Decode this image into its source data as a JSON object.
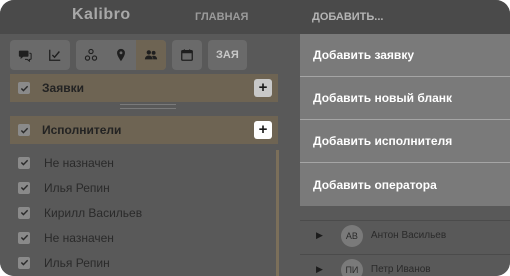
{
  "header": {
    "logo": "Kalibro",
    "nav_home": "ГЛАВНАЯ",
    "nav_add": "ДОБАВИТЬ..."
  },
  "toolbar": {
    "buttons": [
      "chat-icon",
      "checklist-icon",
      "network-icon",
      "map-pin-icon",
      "users-icon",
      "calendar-icon"
    ],
    "active": "users-icon",
    "truncated_label": "ЗАЯ"
  },
  "sections": {
    "requests_label": "Заявки",
    "executors_label": "Исполнители"
  },
  "executors": [
    "Не назначен",
    "Илья Репин",
    "Кирилл Васильев",
    "Не назначен",
    "Илья Репин"
  ],
  "right_list": [
    {
      "initials": "АВ",
      "name": "Антон Васильев"
    },
    {
      "initials": "ПИ",
      "name": "Петр Иванов"
    }
  ],
  "menu": {
    "items": [
      "Добавить заявку",
      "Добавить новый бланк",
      "Добавить исполнителя",
      "Добавить оператора"
    ]
  },
  "colors": {
    "overlay": "#595959",
    "menu": "#7a7a7a",
    "section_active": "#6e6453"
  }
}
